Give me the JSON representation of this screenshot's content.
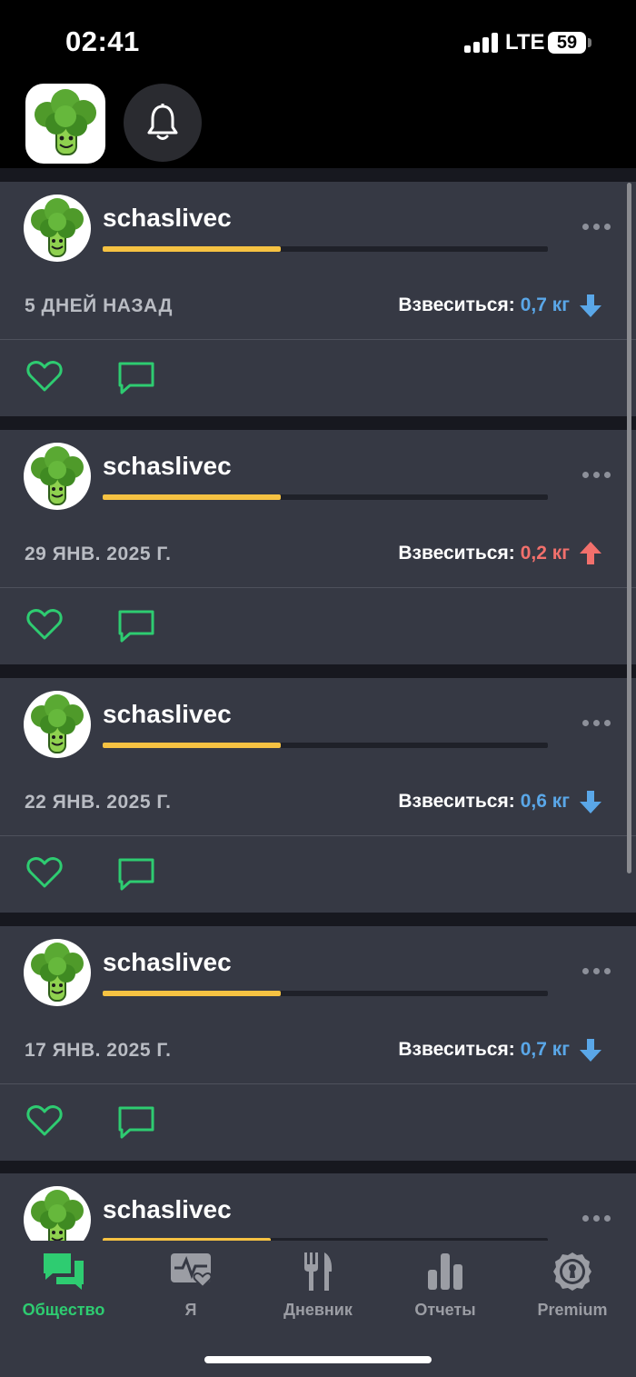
{
  "status_bar": {
    "time": "02:41",
    "network": "LTE",
    "battery": "59"
  },
  "header": {
    "app_icon": "broccoli-logo",
    "notification_icon": "bell-icon"
  },
  "feed": {
    "posts": [
      {
        "username": "schaslivec",
        "progress": 0.4,
        "date": "5 ДНЕЙ НАЗАД",
        "weigh_label": "Взвеситься:",
        "weigh_value": "0,7 кг",
        "direction": "down"
      },
      {
        "username": "schaslivec",
        "progress": 0.4,
        "date": "29 ЯНВ. 2025 Г.",
        "weigh_label": "Взвеситься:",
        "weigh_value": "0,2 кг",
        "direction": "up"
      },
      {
        "username": "schaslivec",
        "progress": 0.4,
        "date": "22 ЯНВ. 2025 Г.",
        "weigh_label": "Взвеситься:",
        "weigh_value": "0,6 кг",
        "direction": "down"
      },
      {
        "username": "schaslivec",
        "progress": 0.4,
        "date": "17 ЯНВ. 2025 Г.",
        "weigh_label": "Взвеситься:",
        "weigh_value": "0,7 кг",
        "direction": "down"
      },
      {
        "username": "schaslivec",
        "progress": 0.378
      }
    ]
  },
  "tabs": [
    {
      "label": "Общество",
      "icon": "chat-bubbles-icon",
      "active": true
    },
    {
      "label": "Я",
      "icon": "health-monitor-icon",
      "active": false
    },
    {
      "label": "Дневник",
      "icon": "fork-knife-icon",
      "active": false
    },
    {
      "label": "Отчеты",
      "icon": "bar-chart-icon",
      "active": false
    },
    {
      "label": "Premium",
      "icon": "keyhole-badge-icon",
      "active": false
    }
  ],
  "colors": {
    "accent_green": "#2ecc71",
    "progress_yellow": "#f6c242",
    "weight_down_blue": "#5aa7e8",
    "weight_up_red": "#f2706c",
    "card_bg": "#363944",
    "feed_bg": "#17181f"
  }
}
